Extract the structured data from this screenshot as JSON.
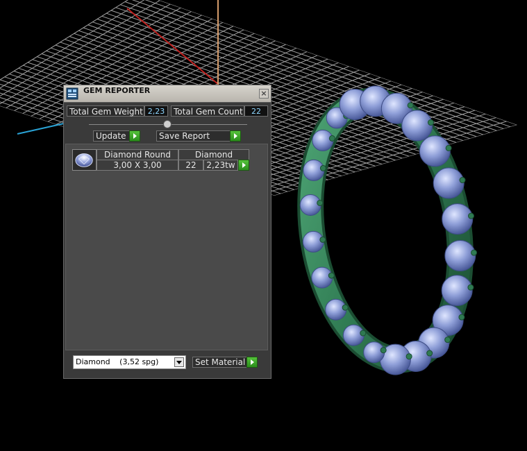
{
  "window": {
    "title": "GEM REPORTER",
    "close_glyph": "×"
  },
  "totals": {
    "weight_label": "Total Gem Weight",
    "weight_value": "2,23",
    "count_label": "Total Gem Count",
    "count_value": "22"
  },
  "actions": {
    "update_label": "Update",
    "save_report_label": "Save Report"
  },
  "report": {
    "rows": [
      {
        "icon": "gem-round-icon",
        "shape": "Diamond Round",
        "material": "Diamond",
        "size": "3,00 X 3,00",
        "count": "22",
        "weight": "2,23tw"
      }
    ]
  },
  "footer": {
    "material_name": "Diamond",
    "material_density": "(3,52 spg)",
    "set_material_label": "Set Material"
  },
  "colors": {
    "panel_bg": "#3a3a3a",
    "value_text": "#8fd6ff",
    "action_green": "#3aa82a",
    "grid": "#bdbdbd",
    "metal_green": "#2f7a52",
    "gem_blue": "#8f9fd8"
  }
}
